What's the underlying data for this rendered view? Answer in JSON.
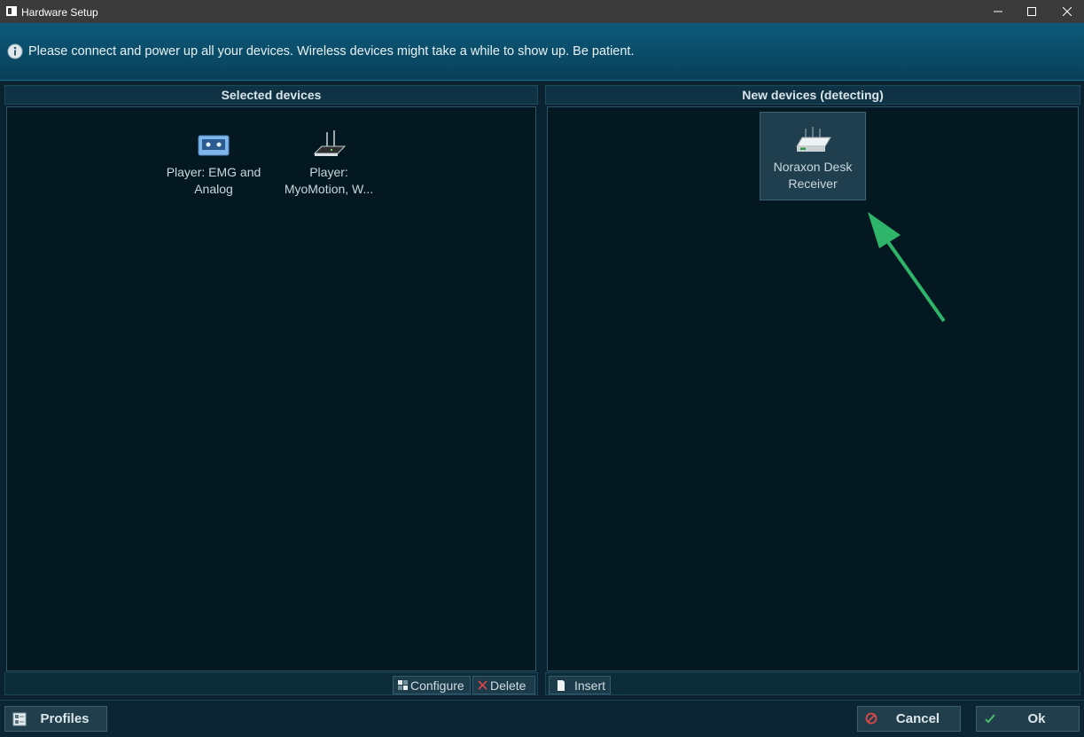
{
  "window": {
    "title": "Hardware Setup"
  },
  "info": {
    "message": "Please connect and power up all your devices. Wireless devices might take a while to show up. Be patient."
  },
  "selected_panel": {
    "header": "Selected devices",
    "devices": [
      {
        "label_line1": "Player: EMG and",
        "label_line2": "Analog",
        "icon": "emg-player-icon"
      },
      {
        "label_line1": "Player:",
        "label_line2": "MyoMotion, W...",
        "icon": "router-icon"
      }
    ],
    "buttons": {
      "configure": "Configure",
      "delete": "Delete"
    }
  },
  "new_panel": {
    "header": "New devices (detecting)",
    "devices": [
      {
        "label_line1": "Noraxon Desk",
        "label_line2": "Receiver",
        "icon": "desk-receiver-icon"
      }
    ],
    "buttons": {
      "insert": "Insert"
    }
  },
  "bottom": {
    "profiles": "Profiles",
    "cancel": "Cancel",
    "ok": "Ok"
  },
  "colors": {
    "arrow": "#2fb56a",
    "accent": "#0a4a66"
  }
}
